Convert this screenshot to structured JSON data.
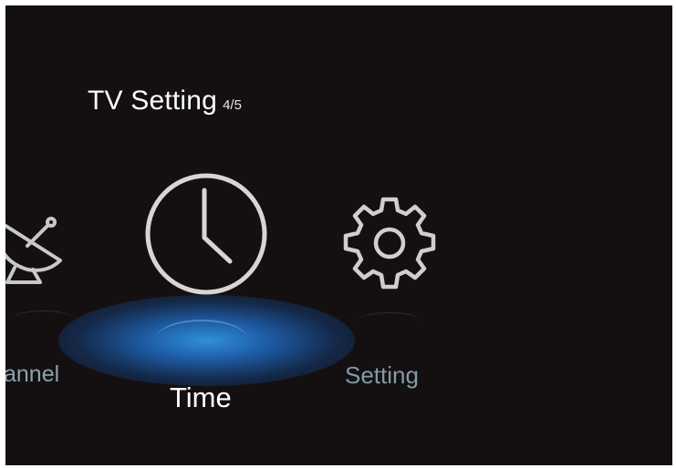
{
  "header": {
    "title": "TV Setting",
    "pager": "4/5"
  },
  "menu": {
    "items": [
      {
        "label": "annel",
        "icon": "satellite-dish-icon",
        "focused": false
      },
      {
        "label": "Time",
        "icon": "clock-icon",
        "focused": true
      },
      {
        "label": "Setting",
        "icon": "gear-icon",
        "focused": false
      }
    ]
  },
  "colors": {
    "background": "#141011",
    "focus_glow": "#2f8fe0",
    "label_inactive": "#8aa2ad",
    "label_active": "#ffffff"
  }
}
